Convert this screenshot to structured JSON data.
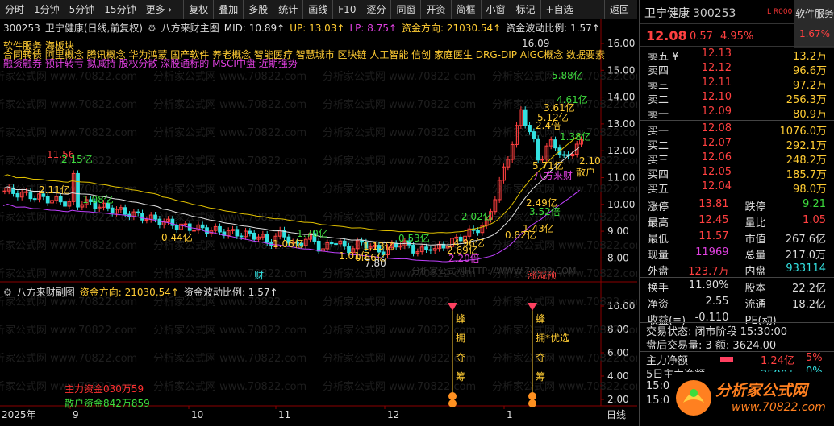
{
  "toolbar": {
    "items": [
      "分时",
      "1分钟",
      "5分钟",
      "15分钟",
      "更多 ›",
      "复权",
      "叠加",
      "多股",
      "统计",
      "画线",
      "F10",
      "逐分",
      "同窗",
      "开资",
      "简框",
      "小窗",
      "标记",
      "+自选",
      "返回"
    ]
  },
  "main": {
    "header": {
      "code": "300253",
      "name": "卫宁健康(日线,前复权)",
      "indicator": "八方来财主图",
      "mid": "MID: 10.89↑",
      "up": "UP: 13.03↑",
      "lp": "LP: 8.75↑",
      "fund_dir": "资金方向: 21030.54↑",
      "fund_wave": "资金波动比例: 1.57↑"
    },
    "tags": {
      "line1": "软件服务 海板块",
      "line2": "合同转债 阿里概念 腾讯概念 华为鸿蒙 国产软件 养老概念 智能医疗 智慧城市 区块链 人工智能 信创 家庭医生 DRG-DIP AIGC概念 数据要素",
      "line3": "融资融券 预计转亏 拟减持 股权分散 深股通标的 MSCI中盘 近期强势"
    },
    "y_ticks": [
      "16.00",
      "15.00",
      "14.00",
      "13.00",
      "12.00",
      "11.00",
      "10.00",
      "9.00",
      "8.00"
    ],
    "annotations": {
      "high_label": "11.56",
      "high_amt": "2.15亿",
      "a1": "2.11亿",
      "a2": "1.08亿",
      "a3": "0.44亿",
      "a4": "1.06亿",
      "a5": "1.70亿",
      "a6": "1.13亿",
      "a7": "0.53亿",
      "a8": "2.02亿",
      "a9": "4.96亿",
      "a10": "2.69亿",
      "a11": "2.20倍",
      "a12": "1.43亿",
      "a13": "0.82亿",
      "a14": "2.49亿",
      "a15": "3.52倍",
      "a16": "16.09",
      "a17": "5.88亿",
      "a18": "4.61亿",
      "a19": "3.61亿",
      "a20": "5.12亿",
      "a21": "2.4倍",
      "a22": "1.38亿",
      "a23": "5.71亿",
      "a24": "八方来财",
      "a25": "2.10",
      "a26": "散户",
      "a27": "1.01亿",
      "a28": "0.66亿",
      "a29": "7.80",
      "a30": "财",
      "a31": "涨减预"
    },
    "watermark": "分析家公式网 www.70822.com",
    "watermark_url": "分析家公式网HTTP://WWW.70822.COM"
  },
  "sub": {
    "header": {
      "name": "八方来财副图",
      "fund_dir": "资金方向: 21030.54↑",
      "fund_wave": "资金波动比例: 1.57↑"
    },
    "y_ticks": [
      "10.00",
      "8.00",
      "6.00",
      "4.00",
      "2.00"
    ],
    "label_main": "主力资金030万59",
    "label_retail": "散户资金842万859",
    "markers": [
      {
        "chars": [
          "蜂",
          "拥",
          "夺",
          "筹"
        ]
      },
      {
        "chars": [
          "蜂",
          "拥*优选",
          "夺",
          "筹"
        ]
      }
    ]
  },
  "xaxis": {
    "labels": [
      "2025年",
      "9",
      "10",
      "11",
      "12",
      "1",
      "日线"
    ]
  },
  "panel": {
    "name": "卫宁健康",
    "code": "300253",
    "flag": "L R000",
    "service": "软件服务",
    "service_pct": "1.67%",
    "price": "12.08",
    "change": "0.57",
    "pct": "4.95%",
    "asks": [
      {
        "label": "卖五 ¥",
        "price": "12.13",
        "vol": "13.2万"
      },
      {
        "label": "卖四",
        "price": "12.12",
        "vol": "96.6万"
      },
      {
        "label": "卖三",
        "price": "12.11",
        "vol": "97.2万"
      },
      {
        "label": "卖二",
        "price": "12.10",
        "vol": "256.3万"
      },
      {
        "label": "卖一",
        "price": "12.09",
        "vol": "80.9万"
      }
    ],
    "bids": [
      {
        "label": "买一",
        "price": "12.08",
        "vol": "1076.0万"
      },
      {
        "label": "买二",
        "price": "12.07",
        "vol": "292.1万"
      },
      {
        "label": "买三",
        "price": "12.06",
        "vol": "248.2万"
      },
      {
        "label": "买四",
        "price": "12.05",
        "vol": "185.7万"
      },
      {
        "label": "买五",
        "price": "12.04",
        "vol": "98.0万"
      }
    ],
    "stats1": [
      {
        "k": "涨停",
        "v": "13.81",
        "c": "c-red"
      },
      {
        "k": "跌停",
        "v": "9.21",
        "c": "c-green"
      },
      {
        "k": "最高",
        "v": "12.45",
        "c": "c-red"
      },
      {
        "k": "量比",
        "v": "1.05",
        "c": "c-red"
      },
      {
        "k": "最低",
        "v": "11.57",
        "c": "c-red"
      },
      {
        "k": "市值",
        "v": "267.6亿",
        "c": "c-white"
      },
      {
        "k": "现量",
        "v": "11969",
        "c": "c-magenta"
      },
      {
        "k": "总量",
        "v": "217.0万",
        "c": "c-white"
      },
      {
        "k": "外盘",
        "v": "123.7万",
        "c": "c-red"
      },
      {
        "k": "内盘",
        "v": "933114",
        "c": "c-cyan"
      }
    ],
    "stats2": [
      {
        "k": "换手",
        "v": "11.90%",
        "c": "c-white"
      },
      {
        "k": "股本",
        "v": "22.2亿",
        "c": "c-white"
      },
      {
        "k": "净资",
        "v": "2.55",
        "c": "c-white"
      },
      {
        "k": "流通",
        "v": "18.2亿",
        "c": "c-white"
      },
      {
        "k": "收益(≡)",
        "v": "-0.110",
        "c": "c-white"
      },
      {
        "k": "PE(动)",
        "v": "",
        "c": "c-white"
      }
    ],
    "trade_state": "交易状态: 闭市阶段 15:30:00",
    "after_vol": "盘后交易量: 3  额: 3624.00",
    "main_net_label": "主力净额",
    "main_net_value": "1.24亿",
    "main_net_pct": "5%",
    "d5_label": "5日主力净额",
    "d5_value": "2590万",
    "d5_pct": "0%",
    "time1": "15:0",
    "time2": "15:0",
    "logo_text": "分析家公式网",
    "logo_url": "www.70822.com"
  },
  "colors": {
    "up": "#ff4040",
    "down": "#33e0e0",
    "ma_yellow": "#e0c000",
    "ma_white": "#e0e0e0",
    "ma_magenta": "#c040ff"
  }
}
